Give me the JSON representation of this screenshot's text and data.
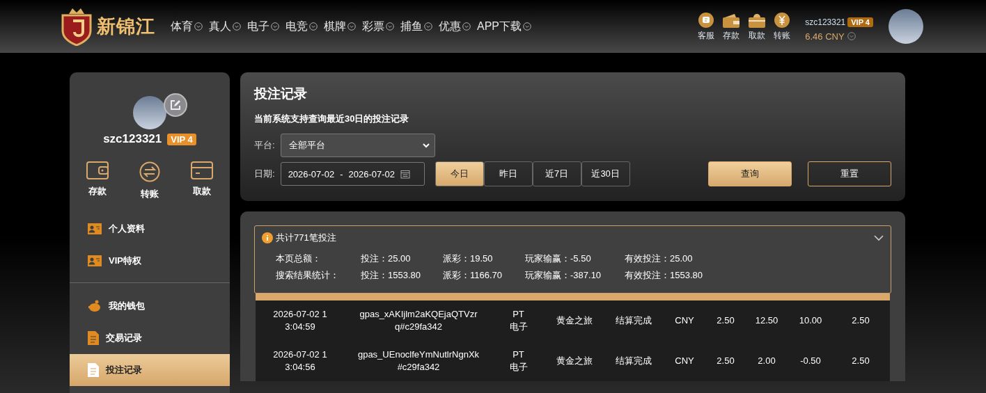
{
  "header": {
    "logo_text": "新锦江",
    "nav": [
      "体育",
      "真人",
      "电子",
      "电竞",
      "棋牌",
      "彩票",
      "捕鱼",
      "优惠",
      "APP下载"
    ],
    "quick_actions": [
      {
        "kind": "service",
        "label": "客服"
      },
      {
        "kind": "deposit",
        "label": "存款"
      },
      {
        "kind": "withdraw",
        "label": "取款"
      },
      {
        "kind": "transfer",
        "label": "转账"
      }
    ],
    "username": "szc123321",
    "vip": "VIP 4",
    "balance": "6.46 CNY"
  },
  "sidebar": {
    "username": "szc123321",
    "vip": "VIP 4",
    "actions": [
      {
        "kind": "deposit",
        "label": "存款"
      },
      {
        "kind": "transfer",
        "label": "转账"
      },
      {
        "kind": "withdraw",
        "label": "取款"
      }
    ],
    "groups": [
      [
        {
          "kind": "profile",
          "label": "个人资料",
          "selected": false
        },
        {
          "kind": "profile",
          "label": "VIP特权",
          "selected": false
        }
      ],
      [
        {
          "kind": "wallet",
          "label": "我的钱包",
          "selected": false
        },
        {
          "kind": "doc",
          "label": "交易记录",
          "selected": false
        },
        {
          "kind": "doc",
          "label": "投注记录",
          "selected": true
        }
      ]
    ]
  },
  "filter": {
    "title": "投注记录",
    "note": "当前系统支持查询最近30日的投注记录",
    "platform_label": "平台:",
    "platform_value": "全部平台",
    "date_label": "日期:",
    "date_from": "2026-07-02",
    "date_separator": "-",
    "date_to": "2026-07-02",
    "ranges": [
      {
        "label": "今日",
        "selected": true
      },
      {
        "label": "昨日",
        "selected": false
      },
      {
        "label": "近7日",
        "selected": false
      },
      {
        "label": "近30日",
        "selected": false
      }
    ],
    "buttons": [
      {
        "kind": "primary",
        "label": "查询"
      },
      {
        "kind": "outline",
        "label": "重置"
      }
    ]
  },
  "summary": {
    "title": "共计771笔投注",
    "expanded": true,
    "rows": [
      [
        "本页总额：",
        "投注：25.00",
        "派彩：19.50",
        "玩家输赢：-5.50",
        "有效投注：25.00"
      ],
      [
        "搜索结果统计：",
        "投注：1553.80",
        "派彩：1166.70",
        "玩家输赢：-387.10",
        "有效投注：1553.80"
      ]
    ]
  },
  "table": {
    "rows": [
      [
        "2026-07-02 13:04:59",
        "gpas_xAKIjlm2aKQEjaQTVzrq#c29fa342",
        "PT 电子",
        "黄金之旅",
        "结算完成",
        "CNY",
        "2.50",
        "12.50",
        "10.00",
        "2.50"
      ],
      [
        "2026-07-02 13:04:56",
        "gpas_UEnoclfeYmNutlrNgnXk#c29fa342",
        "PT 电子",
        "黄金之旅",
        "结算完成",
        "CNY",
        "2.50",
        "2.00",
        "-0.50",
        "2.50"
      ]
    ]
  }
}
